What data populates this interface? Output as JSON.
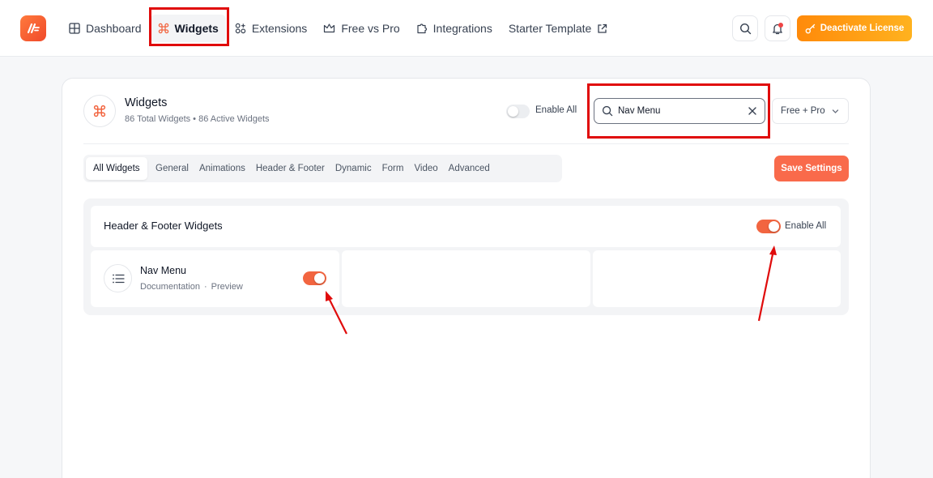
{
  "nav": {
    "items": [
      {
        "label": "Dashboard",
        "icon": "grid-icon"
      },
      {
        "label": "Widgets",
        "icon": "command-icon",
        "active": true
      },
      {
        "label": "Extensions",
        "icon": "extensions-icon"
      },
      {
        "label": "Free vs Pro",
        "icon": "crown-icon"
      },
      {
        "label": "Integrations",
        "icon": "puzzle-icon"
      },
      {
        "label": "Starter Template",
        "icon": "external-link-icon"
      }
    ],
    "license_button": "Deactivate License"
  },
  "header": {
    "title": "Widgets",
    "subtitle": "86 Total Widgets • 86 Active Widgets",
    "enable_all_label": "Enable All",
    "enable_all_on": false,
    "search_value": "Nav Menu",
    "filter_value": "Free + Pro"
  },
  "tabs": [
    {
      "label": "All Widgets",
      "active": true
    },
    {
      "label": "General"
    },
    {
      "label": "Animations"
    },
    {
      "label": "Header & Footer"
    },
    {
      "label": "Dynamic"
    },
    {
      "label": "Form"
    },
    {
      "label": "Video"
    },
    {
      "label": "Advanced"
    }
  ],
  "save_label": "Save Settings",
  "section": {
    "title": "Header & Footer Widgets",
    "enable_all_label": "Enable All",
    "enable_all_on": true
  },
  "widget": {
    "title": "Nav Menu",
    "doc_label": "Documentation",
    "separator": "·",
    "preview_label": "Preview",
    "enabled": true
  },
  "colors": {
    "accent": "#f26540",
    "highlight": "#e00b0b",
    "license_start": "#ff8a0a",
    "license_end": "#ffb21f"
  }
}
